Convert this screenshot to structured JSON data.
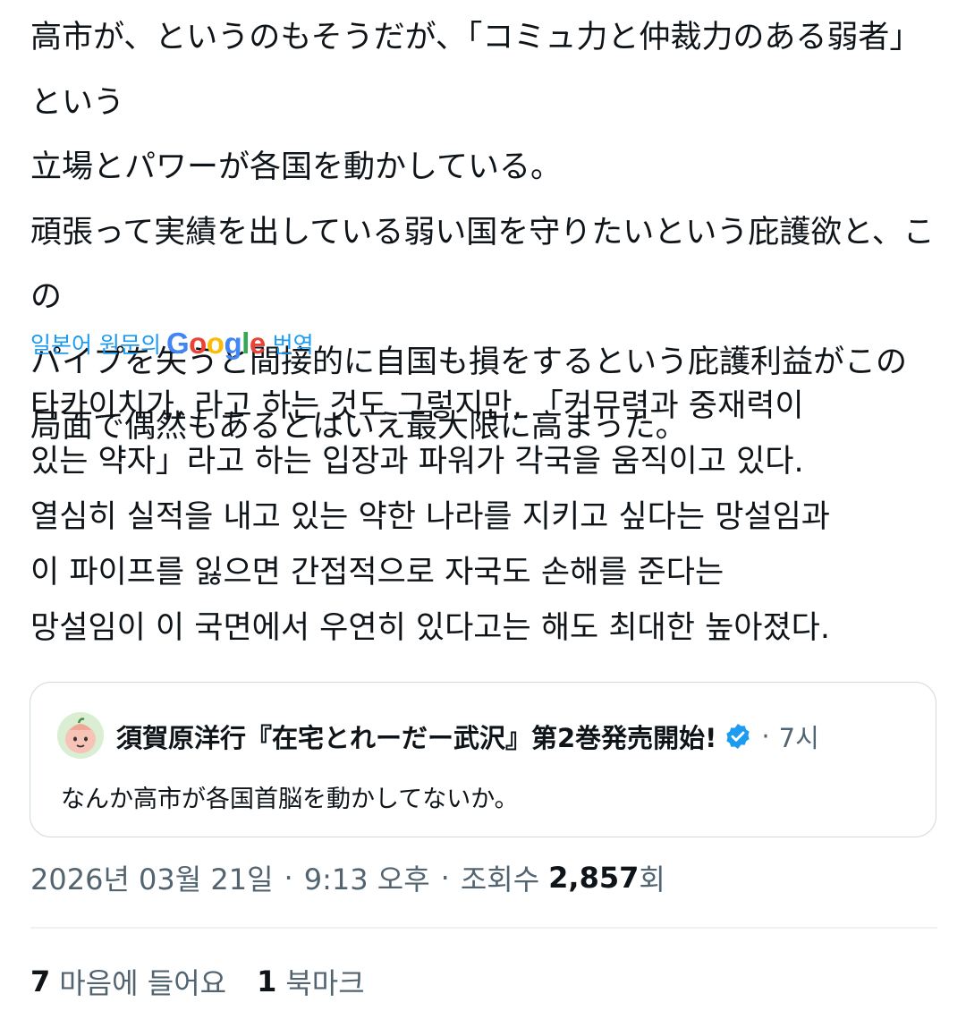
{
  "post": {
    "text": "高市が、というのもそうだが、「コミュ力と仲裁力のある弱者」という\n立場とパワーが各国を動かしている。\n頑張って実績を出している弱い国を守りたいという庇護欲と、この\nパイプを失うと間接的に自国も損をするという庇護利益がこの\n局面で偶然もあるとはいえ最大限に高まった。"
  },
  "translation": {
    "lead": "일본어 원문의",
    "google_logo": [
      "G",
      "o",
      "o",
      "g",
      "l",
      "e"
    ],
    "google_colors": [
      "#4285f4",
      "#ea4335",
      "#fbbc05",
      "#4285f4",
      "#34a853",
      "#ea4335"
    ],
    "action": "번역",
    "text": "타카이치가, 라고 하는 것도 그렇지만, 「커뮤력과 중재력이\n있는 약자」라고 하는 입장과 파워가 각국을 움직이고 있다.\n열심히 실적을 내고 있는 약한 나라를 지키고 싶다는 망설임과\n이 파이프를 잃으면 간접적으로 자국도 손해를 준다는\n망설임이 이 국면에서 우연히 있다고는 해도 최대한 높아졌다."
  },
  "quote": {
    "avatar_icon": "avatar-peach-character",
    "author_name": "須賀原洋行『在宅とれーだー武沢』第2巻発売開始!",
    "verified_icon": "verified-badge-icon",
    "separator": "·",
    "time": "7시",
    "text": "なんか高市が各国首脳を動かしてないか。"
  },
  "meta": {
    "date": "2026년 03월 21일",
    "separator": "·",
    "time": "9:13 오후",
    "views_label": "조회수",
    "views_count": "2,857",
    "views_suffix": "회"
  },
  "stats": {
    "likes_count": "7",
    "likes_label": "마음에 들어요",
    "bookmarks_count": "1",
    "bookmarks_label": "북마크"
  },
  "colors": {
    "text": "#0f1419",
    "secondary": "#536471",
    "link": "#1d9bf0",
    "border": "#cfd9de",
    "verified": "#1d9bf0"
  }
}
